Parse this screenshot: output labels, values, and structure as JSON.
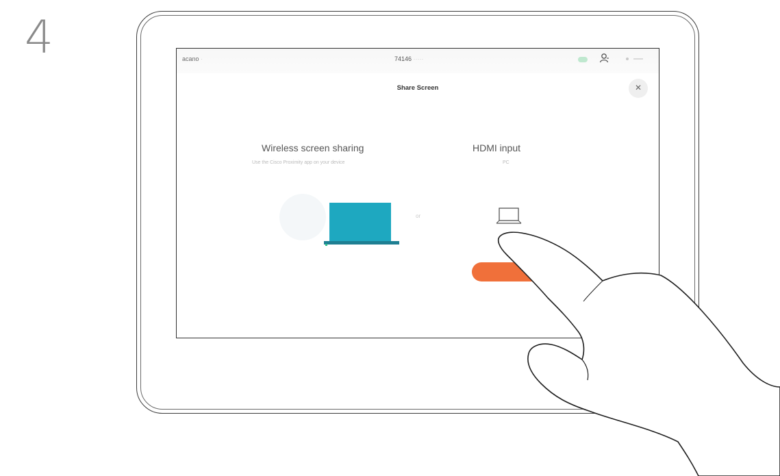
{
  "step": {
    "number": "4"
  },
  "topbar": {
    "left_text": "acano",
    "center_number": "74146"
  },
  "panel": {
    "title": "Share Screen",
    "close_glyph": "✕"
  },
  "options": {
    "wireless": {
      "title": "Wireless screen sharing",
      "subtitle": "Use the Cisco Proximity app on your device"
    },
    "hdmi": {
      "title": "HDMI input",
      "subtitle": "PC"
    }
  },
  "or_label": "or",
  "icons": {
    "user": "user-icon",
    "close": "close-icon",
    "laptop": "laptop-icon",
    "hand": "hand-pointer-illustration"
  },
  "colors": {
    "accent_orange": "#f0703a",
    "screen_teal": "#1ea8c0",
    "status_green": "#bfe8cf"
  }
}
